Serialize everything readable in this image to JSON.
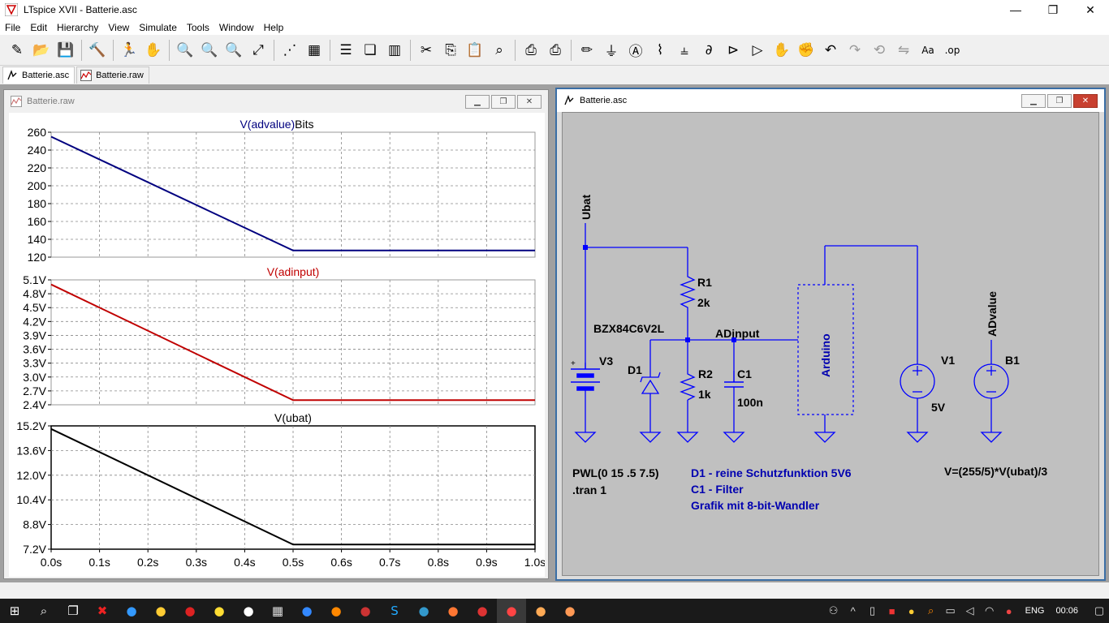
{
  "window": {
    "title": "LTspice XVII - Batterie.asc",
    "minimize": "—",
    "maximize": "❐",
    "close": "✕"
  },
  "menu": [
    "File",
    "Edit",
    "Hierarchy",
    "View",
    "Simulate",
    "Tools",
    "Window",
    "Help"
  ],
  "toolbar_icons": [
    "new-schematic-icon",
    "open-icon",
    "save-icon",
    "control-panel-icon",
    "run-icon",
    "halt-icon",
    "zoom-in-icon",
    "zoom-pan-icon",
    "zoom-out-icon",
    "zoom-fit-icon",
    "autorange-icon",
    "grid-icon",
    "tile-horizontal-icon",
    "cascade-icon",
    "tile-vertical-icon",
    "cut-icon",
    "copy-icon",
    "paste-icon",
    "find-icon",
    "print-icon",
    "print-preview-icon",
    "draw-wire-icon",
    "ground-icon",
    "label-net-icon",
    "resistor-icon",
    "capacitor-icon",
    "inductor-icon",
    "diode-icon",
    "component-icon",
    "move-icon",
    "drag-icon",
    "undo-icon",
    "redo-icon",
    "rotate-icon",
    "mirror-icon",
    "text-icon",
    "spice-directive-icon"
  ],
  "tabs": [
    {
      "label": "Batterie.asc",
      "active": true
    },
    {
      "label": "Batterie.raw",
      "active": false
    }
  ],
  "plot_window": {
    "title": "Batterie.raw",
    "panes": [
      {
        "trace": "V(advalue)",
        "suffix": "Bits",
        "yticks": [
          "260",
          "240",
          "220",
          "200",
          "180",
          "160",
          "140",
          "120"
        ]
      },
      {
        "trace": "V(adinput)",
        "suffix": "",
        "yticks": [
          "5.1V",
          "4.8V",
          "4.5V",
          "4.2V",
          "3.9V",
          "3.6V",
          "3.3V",
          "3.0V",
          "2.7V",
          "2.4V"
        ]
      },
      {
        "trace": "V(ubat)",
        "suffix": "",
        "yticks": [
          "15.2V",
          "13.6V",
          "12.0V",
          "10.4V",
          "8.8V",
          "7.2V"
        ]
      }
    ],
    "xticks": [
      "0.0s",
      "0.1s",
      "0.2s",
      "0.3s",
      "0.4s",
      "0.5s",
      "0.6s",
      "0.7s",
      "0.8s",
      "0.9s",
      "1.0s"
    ]
  },
  "chart_data": [
    {
      "type": "line",
      "title": "V(advalue) Bits",
      "xlabel": "",
      "ylabel": "",
      "xlim": [
        0,
        1.0
      ],
      "ylim": [
        120,
        260
      ],
      "grid": true,
      "series": [
        {
          "name": "V(advalue)",
          "color": "#00007f",
          "x": [
            0,
            0.5,
            1.0
          ],
          "y": [
            255,
            127.5,
            127.5
          ]
        }
      ]
    },
    {
      "type": "line",
      "title": "V(adinput)",
      "xlabel": "",
      "ylabel": "",
      "xlim": [
        0,
        1.0
      ],
      "ylim": [
        2.4,
        5.1
      ],
      "grid": true,
      "series": [
        {
          "name": "V(adinput)",
          "color": "#c00000",
          "x": [
            0,
            0.5,
            1.0
          ],
          "y": [
            5.0,
            2.5,
            2.5
          ]
        }
      ]
    },
    {
      "type": "line",
      "title": "V(ubat)",
      "xlabel": "",
      "ylabel": "",
      "xlim": [
        0,
        1.0
      ],
      "ylim": [
        7.2,
        15.2
      ],
      "grid": true,
      "series": [
        {
          "name": "V(ubat)",
          "color": "#000000",
          "x": [
            0,
            0.5,
            1.0
          ],
          "y": [
            15,
            7.5,
            7.5
          ]
        }
      ]
    }
  ],
  "schematic_window": {
    "title": "Batterie.asc",
    "labels": {
      "ubat": "Ubat",
      "r1": "R1",
      "r1_val": "2k",
      "bzx": "BZX84C6V2L",
      "adinput": "ADinput",
      "v3": "V3",
      "d1": "D1",
      "r2": "R2",
      "r2_val": "1k",
      "c1": "C1",
      "c1_val": "100n",
      "arduino": "Arduino",
      "v1": "V1",
      "v1_val": "5V",
      "advalue": "ADvalue",
      "b1": "B1"
    },
    "directives": {
      "pwl": "PWL(0 15 .5 7.5)",
      "tran": ".tran 1"
    },
    "comments": [
      "D1 - reine Schutzfunktion 5V6",
      "C1 - Filter",
      "Grafik mit 8-bit-Wandler"
    ],
    "b1_expr": "V=(255/5)*V(ubat)/3"
  },
  "taskbar": {
    "apps": [
      "start-icon",
      "search-icon",
      "task-view-icon",
      "app-red-x-icon",
      "browser-icon",
      "file-explorer-icon",
      "app-red-icon",
      "app-yellow-icon",
      "app-shield-icon",
      "calculator-icon",
      "app-blue-icon",
      "app-orange-search-icon",
      "app-red-2-icon",
      "skype-icon",
      "app-edge-icon",
      "firefox-icon",
      "app-pdf-icon",
      "ltspice-icon",
      "app-gear-icon",
      "app-orange-icon"
    ],
    "lang": "ENG",
    "time": "00:06"
  }
}
